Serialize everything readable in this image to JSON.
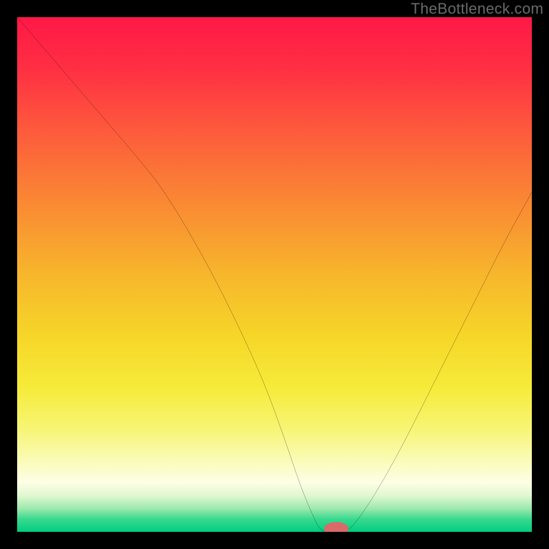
{
  "watermark": "TheBottleneck.com",
  "chart_data": {
    "type": "line",
    "title": "",
    "xlabel": "",
    "ylabel": "",
    "xlim": [
      0,
      100
    ],
    "ylim": [
      0,
      100
    ],
    "background": {
      "type": "vertical-gradient",
      "stops": [
        {
          "pos": 0.0,
          "color": "#ff1846"
        },
        {
          "pos": 0.1,
          "color": "#ff2f43"
        },
        {
          "pos": 0.22,
          "color": "#fd5a3c"
        },
        {
          "pos": 0.35,
          "color": "#fa8534"
        },
        {
          "pos": 0.5,
          "color": "#f7b62c"
        },
        {
          "pos": 0.62,
          "color": "#f6d628"
        },
        {
          "pos": 0.72,
          "color": "#f6eb3a"
        },
        {
          "pos": 0.8,
          "color": "#f7f574"
        },
        {
          "pos": 0.86,
          "color": "#fafbb6"
        },
        {
          "pos": 0.905,
          "color": "#fdfee6"
        },
        {
          "pos": 0.93,
          "color": "#e0f7cf"
        },
        {
          "pos": 0.955,
          "color": "#9be9ae"
        },
        {
          "pos": 0.975,
          "color": "#3ad98f"
        },
        {
          "pos": 1.0,
          "color": "#00ce7f"
        }
      ]
    },
    "series": [
      {
        "name": "bottleneck-curve",
        "stroke": "#000000",
        "stroke_width": 2,
        "x": [
          0,
          6,
          12,
          18,
          24,
          28,
          33,
          38,
          43,
          48,
          52,
          55,
          57.5,
          59,
          62,
          64,
          66,
          70,
          75,
          80,
          85,
          90,
          95,
          100
        ],
        "y": [
          100,
          93,
          86,
          79,
          72,
          67,
          59,
          50,
          40,
          29,
          18,
          9,
          3,
          0,
          0,
          0,
          2,
          8,
          17,
          27,
          37,
          47,
          57,
          66
        ]
      }
    ],
    "marker": {
      "name": "optimal-point",
      "x": 62,
      "y": 0,
      "rx": 2.4,
      "ry": 1.3,
      "fill": "#d86a6a"
    }
  }
}
